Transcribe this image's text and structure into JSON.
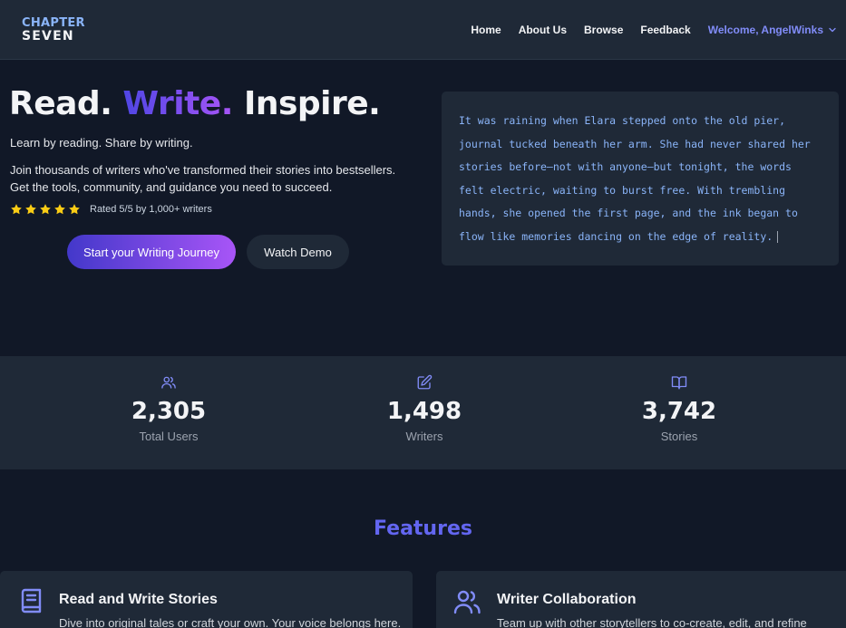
{
  "nav": {
    "logo_line1": "CHAPTER",
    "logo_line2": "SEVEN",
    "links": [
      "Home",
      "About Us",
      "Browse",
      "Feedback"
    ],
    "welcome": "Welcome, AngelWinks"
  },
  "hero": {
    "title_part1": "Read.",
    "title_part2": "Write.",
    "title_part3": "Inspire.",
    "tagline": "Learn by reading. Share by writing.",
    "description": "Join thousands of writers who've transformed their stories into bestsellers. Get the tools, community, and guidance you need to succeed.",
    "rating_value": 5,
    "rating_text": "Rated 5/5 by 1,000+ writers",
    "primary_button": "Start your Writing Journey",
    "secondary_button": "Watch Demo"
  },
  "story_preview": {
    "text": "It was raining when Elara stepped onto the old pier, journal tucked beneath her arm. She had never shared her stories before—not with anyone—but tonight, the words felt electric, waiting to burst free. With trembling hands, she opened the first page, and the ink began to flow like memories dancing on the edge of reality."
  },
  "stats": [
    {
      "icon": "users-icon",
      "value": "2,305",
      "label": "Total Users"
    },
    {
      "icon": "edit-icon",
      "value": "1,498",
      "label": "Writers"
    },
    {
      "icon": "book-open-icon",
      "value": "3,742",
      "label": "Stories"
    }
  ],
  "features": {
    "title": "Features",
    "cards": [
      {
        "icon": "book-icon",
        "title": "Read and Write Stories",
        "description": "Dive into original tales or craft your own. Your voice belongs here."
      },
      {
        "icon": "users-icon",
        "title": "Writer Collaboration",
        "description": "Team up with other storytellers to co-create, edit, and refine"
      }
    ]
  },
  "colors": {
    "accent": "#6366f1",
    "gradient_start": "#4338ca",
    "gradient_end": "#a855f7",
    "star": "#facc15",
    "story_text": "#8ab4f8"
  }
}
